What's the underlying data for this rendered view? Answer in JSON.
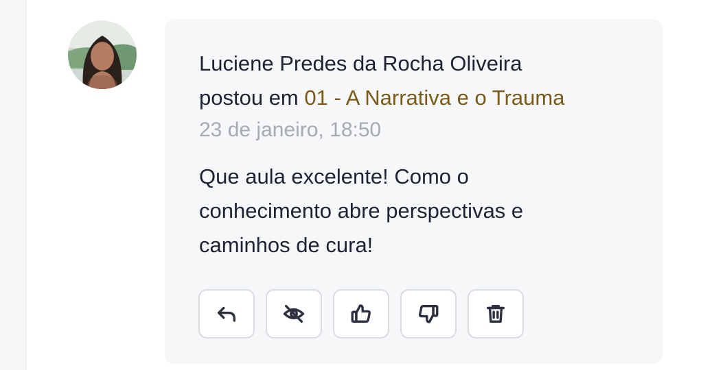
{
  "post": {
    "author_name": "Luciene Predes da Rocha Oliveira",
    "posted_in_prefix": "postou em ",
    "lesson_title": "01 - A Narrativa e o Trauma",
    "timestamp": "23 de janeiro, 18:50",
    "body": "Que aula excelente! Como o conhecimento abre perspectivas e caminhos de cura!"
  },
  "actions": [
    {
      "id": "reply",
      "icon": "reply-icon"
    },
    {
      "id": "hide",
      "icon": "eye-off-icon"
    },
    {
      "id": "like",
      "icon": "thumbs-up-icon"
    },
    {
      "id": "dislike",
      "icon": "thumbs-down-icon"
    },
    {
      "id": "delete",
      "icon": "trash-icon"
    }
  ],
  "colors": {
    "card_background": "#f6f7f9",
    "text_primary": "#1f2233",
    "link_accent": "#7a5a16",
    "timestamp": "#a7aab3",
    "button_border": "#d8dbe2"
  }
}
